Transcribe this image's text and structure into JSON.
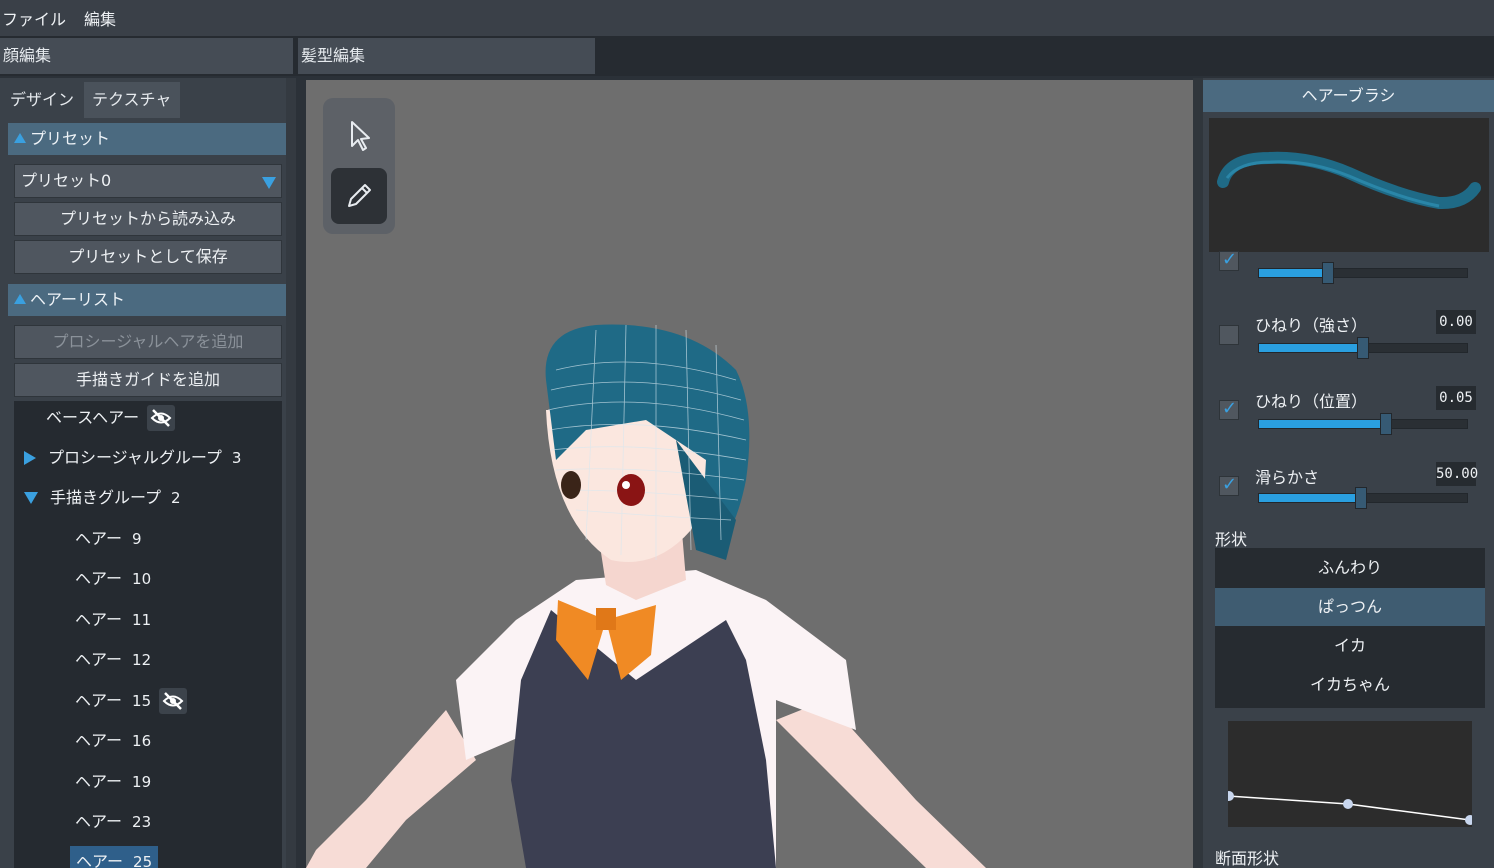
{
  "menu": [
    "ファイル",
    "編集"
  ],
  "mode_tabs": [
    "顔編集",
    "髪型編集"
  ],
  "left": {
    "subtabs": [
      "デザイン",
      "テクスチャ"
    ],
    "preset_header": "プリセット",
    "preset_select": "プリセット0",
    "load_button": "プリセットから読み込み",
    "save_button": "プリセットとして保存",
    "hairlist_header": "ヘアーリスト",
    "add_procedural_button": "プロシージャルヘアを追加",
    "add_guide_button": "手描きガイドを追加",
    "tree": {
      "base": "ベースヘアー",
      "procedural_group": "プロシージャルグループ",
      "procedural_count": "3",
      "hand_group": "手描きグループ",
      "hand_count": "2",
      "items": [
        {
          "label": "ヘアー",
          "num": "9"
        },
        {
          "label": "ヘアー",
          "num": "10"
        },
        {
          "label": "ヘアー",
          "num": "11"
        },
        {
          "label": "ヘアー",
          "num": "12"
        },
        {
          "label": "ヘアー",
          "num": "15"
        },
        {
          "label": "ヘアー",
          "num": "16"
        },
        {
          "label": "ヘアー",
          "num": "19"
        },
        {
          "label": "ヘアー",
          "num": "23"
        },
        {
          "label": "ヘアー",
          "num": "25"
        }
      ]
    }
  },
  "tools": [
    "cursor-icon",
    "pencil-icon"
  ],
  "right": {
    "header": "ヘアーブラシ",
    "params": [
      {
        "label": "",
        "value": "",
        "checked": true,
        "level": 0.33
      },
      {
        "label": "ひねり（強さ）",
        "value": "0.00",
        "checked": false,
        "level": 0.5
      },
      {
        "label": "ひねり（位置）",
        "value": "0.05",
        "checked": true,
        "level": 0.61
      },
      {
        "label": "滑らかさ",
        "value": "50.00",
        "checked": true,
        "level": 0.49
      }
    ],
    "shape_title": "形状",
    "shapes": [
      "ふんわり",
      "ぱっつん",
      "イカ",
      "イカちゃん"
    ],
    "selected_shape": "ぱっつん",
    "section_title": "断面形状"
  },
  "colors": {
    "accent": "#2a9fe0",
    "header": "#4b6a80",
    "hair": "#1f6a86",
    "bow": "#f08a24",
    "vest": "#3c3f52"
  }
}
